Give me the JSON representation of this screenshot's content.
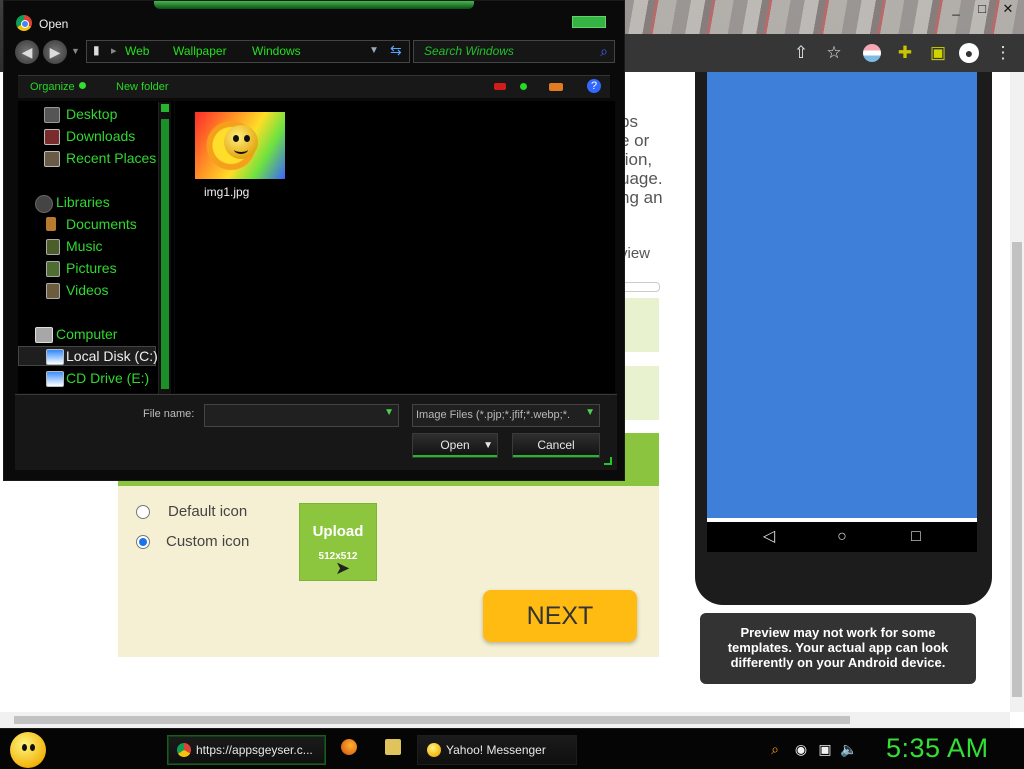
{
  "dialog": {
    "title": "Open",
    "breadcrumbs": [
      "Web",
      "Wallpaper",
      "Windows"
    ],
    "search_placeholder": "Search Windows",
    "toolbar": {
      "organize_label": "Organize",
      "new_folder_label": "New folder",
      "help_label": "?"
    },
    "nav": [
      {
        "label": "Desktop",
        "icon": "desktop-folder-icon"
      },
      {
        "label": "Downloads",
        "icon": "downloads-folder-icon"
      },
      {
        "label": "Recent Places",
        "icon": "recent-places-icon"
      },
      {
        "label": "Libraries",
        "icon": "libraries-icon"
      },
      {
        "label": "Documents",
        "icon": "documents-library-icon"
      },
      {
        "label": "Music",
        "icon": "music-library-icon"
      },
      {
        "label": "Pictures",
        "icon": "pictures-library-icon"
      },
      {
        "label": "Videos",
        "icon": "videos-library-icon"
      },
      {
        "label": "Computer",
        "icon": "computer-icon"
      },
      {
        "label": "Local Disk (C:)",
        "icon": "local-disk-icon"
      },
      {
        "label": "CD Drive (E:)",
        "icon": "cd-drive-icon"
      }
    ],
    "files": [
      {
        "name": "img1.jpg",
        "icon": "image-file-thumbnail"
      }
    ],
    "file_name_label": "File name:",
    "file_name_value": "",
    "file_type_value": "Image Files (*.pjp;*.jfif;*.webp;*.",
    "open_label": "Open",
    "open_dropdown_icon": "chevron-down-icon",
    "cancel_label": "Cancel"
  },
  "page": {
    "partial_text_lines": [
      "ps",
      "e or",
      "tion,",
      "uage.",
      "ng an"
    ],
    "preview_partial": "view",
    "icon_options": [
      "Default icon",
      "Custom icon"
    ],
    "selected_icon_option": "Custom icon",
    "upload_label": "Upload",
    "upload_size": "512x512",
    "next_label": "NEXT",
    "preview_note": "Preview may not work for some templates. Your actual app can look differently on your Android device.",
    "colors": {
      "phone_screen": "#3d7fd9",
      "accent_green": "#8bc43f",
      "next_button": "#ffbb12",
      "dialog_green": "#22c828"
    }
  },
  "taskbar": {
    "items": [
      {
        "label": "https://appsgeyser.c...",
        "icon": "chrome-icon"
      },
      {
        "label": "Yahoo! Messenger",
        "icon": "smiley-icon"
      }
    ],
    "pinned_icons": [
      "firefox-icon",
      "folder-icon"
    ],
    "tray_icons": [
      "search-icon",
      "status-icon",
      "network-icon",
      "volume-icon"
    ],
    "clock": "5:35 AM"
  },
  "browser": {
    "window_controls": [
      "_",
      "□",
      "✕"
    ],
    "toolbar_icons": [
      "share-icon",
      "star-icon",
      "profile-chip-icon",
      "extensions-icon",
      "sidebar-icon",
      "avatar-icon",
      "more-icon"
    ]
  }
}
